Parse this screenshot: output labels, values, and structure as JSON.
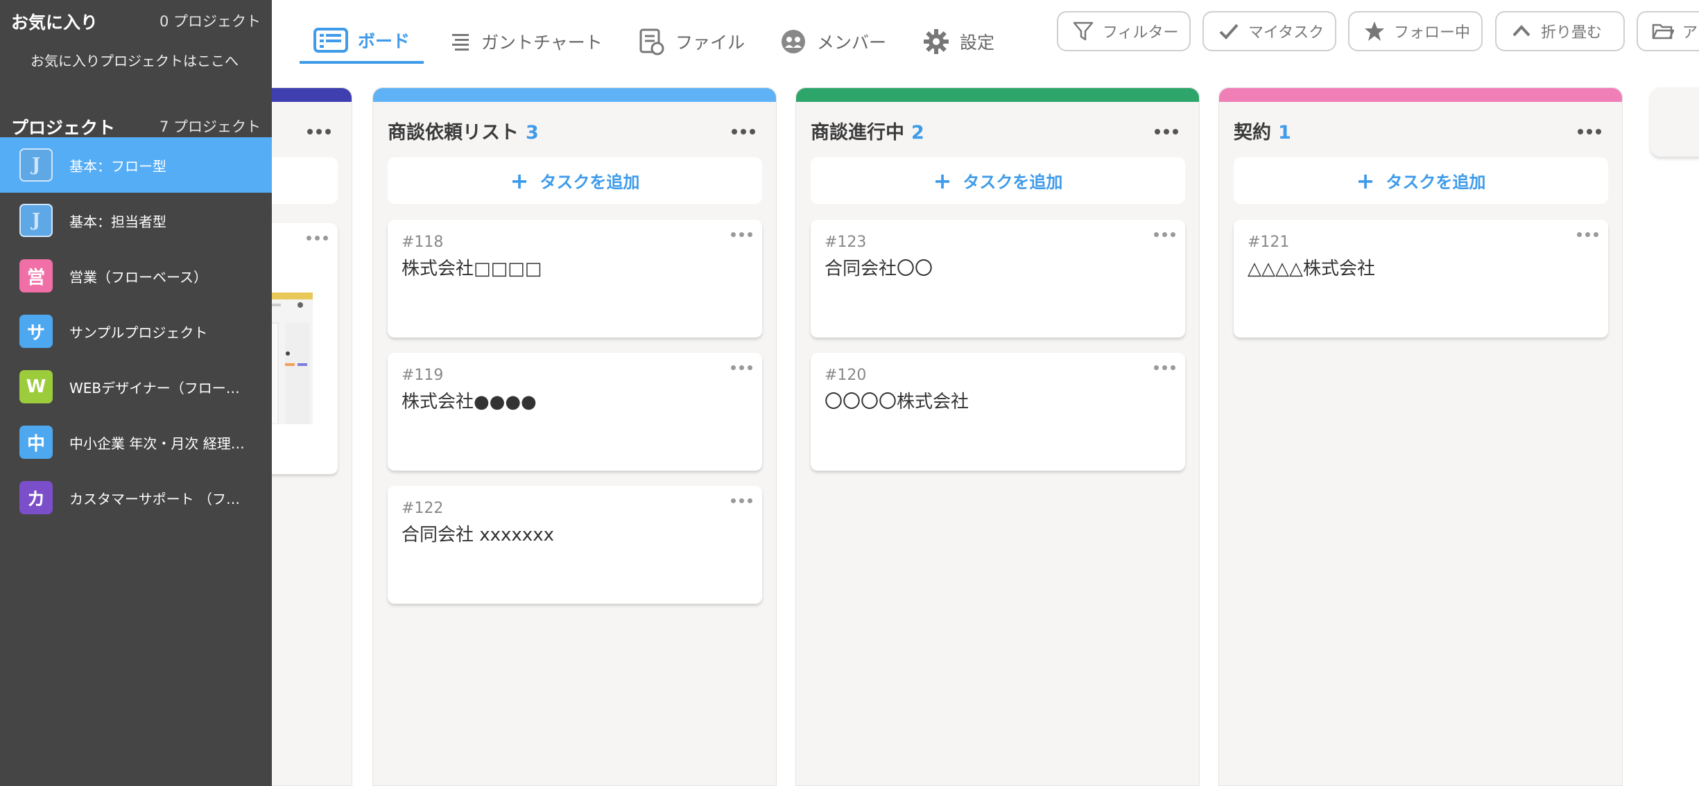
{
  "tabs": [
    {
      "label": "ボード",
      "icon": "board-icon",
      "active": true
    },
    {
      "label": "ガントチャート",
      "icon": "gantt-icon"
    },
    {
      "label": "ファイル",
      "icon": "file-icon"
    },
    {
      "label": "メンバー",
      "icon": "members-icon"
    },
    {
      "label": "設定",
      "icon": "gear-icon"
    }
  ],
  "toolbar": {
    "filter": "フィルター",
    "my_tasks": "マイタスク",
    "following": "フォロー中",
    "collapse": "折り畳む",
    "archive": "ア"
  },
  "sidebar": {
    "favorites_title": "お気に入り",
    "favorites_count": "0 プロジェクト",
    "favorites_placeholder": "お気に入りプロジェクトはここへ",
    "projects_title": "プロジェクト",
    "projects_count": "7 プロジェクト",
    "projects": [
      {
        "label": "基本：フロー型",
        "icon": "J",
        "color": "#5fa8e6",
        "active": true
      },
      {
        "label": "基本：担当者型",
        "icon": "J",
        "color": "#5fa8e6"
      },
      {
        "label": "営業（フローベース）",
        "icon": "営",
        "color": "#f06fa6"
      },
      {
        "label": "サンプルプロジェクト",
        "icon": "サ",
        "color": "#4ea8f0"
      },
      {
        "label": "WEBデザイナー（フロー…",
        "icon": "W",
        "color": "#9ccc3c"
      },
      {
        "label": "中小企業 年次・月次 経理…",
        "icon": "中",
        "color": "#4ea8f0"
      },
      {
        "label": "カスタマーサポート （フ…",
        "icon": "カ",
        "color": "#7b4fc9"
      }
    ]
  },
  "board": {
    "add_task_label": "タスクを追加",
    "columns": [
      {
        "title": "商談依頼リスト",
        "count": "3",
        "color": "#5eb2f5",
        "cards": [
          {
            "num": "#118",
            "title": "株式会社□□□□"
          },
          {
            "num": "#119",
            "title": "株式会社●●●●"
          },
          {
            "num": "#122",
            "title": "合同会社 xxxxxxx"
          }
        ]
      },
      {
        "title": "商談進行中",
        "count": "2",
        "color": "#2ea56a",
        "cards": [
          {
            "num": "#123",
            "title": "合同会社〇〇"
          },
          {
            "num": "#120",
            "title": "〇〇〇〇株式会社"
          }
        ]
      },
      {
        "title": "契約",
        "count": "1",
        "color": "#f07fb8",
        "cards": [
          {
            "num": "#121",
            "title": "△△△△株式会社"
          }
        ]
      }
    ]
  }
}
